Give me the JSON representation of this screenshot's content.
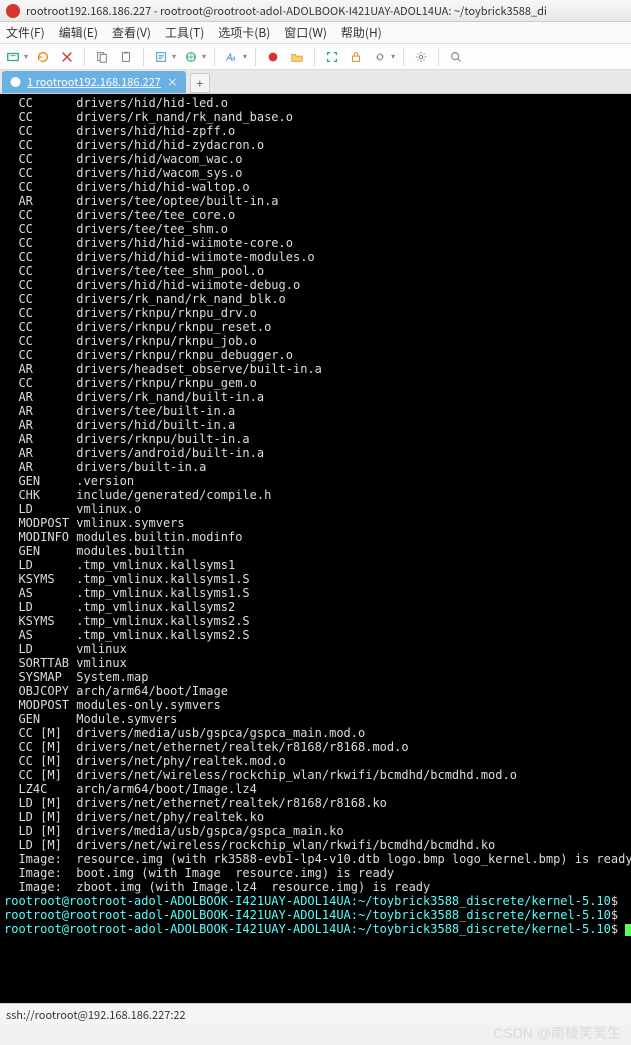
{
  "window": {
    "title": "rootroot192.168.186.227 - rootroot@rootroot-adol-ADOLBOOK-I421UAY-ADOL14UA: ~/toybrick3588_di"
  },
  "menu": {
    "file": "文件(F)",
    "edit": "编辑(E)",
    "view": "查看(V)",
    "tools": "工具(T)",
    "options": "选项卡(B)",
    "window": "窗口(W)",
    "help": "帮助(H)"
  },
  "tab": {
    "label": "1 rootroot192.168.186.227",
    "close": "×",
    "add": "+"
  },
  "status": {
    "text": "ssh://rootroot@192.168.186.227:22"
  },
  "watermark": "CSDN @南棱笑笑生",
  "term": {
    "prompt_path": "rootroot@rootroot-adol-ADOLBOOK-I421UAY-ADOL14UA:~/toybrick3588_discrete/kernel-5.10",
    "dollar": "$",
    "lines": [
      {
        "tag": "CC",
        "txt": "drivers/hid/hid-led.o"
      },
      {
        "tag": "CC",
        "txt": "drivers/rk_nand/rk_nand_base.o"
      },
      {
        "tag": "CC",
        "txt": "drivers/hid/hid-zpff.o"
      },
      {
        "tag": "CC",
        "txt": "drivers/hid/hid-zydacron.o"
      },
      {
        "tag": "CC",
        "txt": "drivers/hid/wacom_wac.o"
      },
      {
        "tag": "CC",
        "txt": "drivers/hid/wacom_sys.o"
      },
      {
        "tag": "CC",
        "txt": "drivers/hid/hid-waltop.o"
      },
      {
        "tag": "AR",
        "txt": "drivers/tee/optee/built-in.a"
      },
      {
        "tag": "CC",
        "txt": "drivers/tee/tee_core.o"
      },
      {
        "tag": "CC",
        "txt": "drivers/tee/tee_shm.o"
      },
      {
        "tag": "CC",
        "txt": "drivers/hid/hid-wiimote-core.o"
      },
      {
        "tag": "CC",
        "txt": "drivers/hid/hid-wiimote-modules.o"
      },
      {
        "tag": "CC",
        "txt": "drivers/tee/tee_shm_pool.o"
      },
      {
        "tag": "CC",
        "txt": "drivers/hid/hid-wiimote-debug.o"
      },
      {
        "tag": "CC",
        "txt": "drivers/rk_nand/rk_nand_blk.o"
      },
      {
        "tag": "CC",
        "txt": "drivers/rknpu/rknpu_drv.o"
      },
      {
        "tag": "CC",
        "txt": "drivers/rknpu/rknpu_reset.o"
      },
      {
        "tag": "CC",
        "txt": "drivers/rknpu/rknpu_job.o"
      },
      {
        "tag": "CC",
        "txt": "drivers/rknpu/rknpu_debugger.o"
      },
      {
        "tag": "AR",
        "txt": "drivers/headset_observe/built-in.a"
      },
      {
        "tag": "CC",
        "txt": "drivers/rknpu/rknpu_gem.o"
      },
      {
        "tag": "AR",
        "txt": "drivers/rk_nand/built-in.a"
      },
      {
        "tag": "AR",
        "txt": "drivers/tee/built-in.a"
      },
      {
        "tag": "AR",
        "txt": "drivers/hid/built-in.a"
      },
      {
        "tag": "AR",
        "txt": "drivers/rknpu/built-in.a"
      },
      {
        "tag": "AR",
        "txt": "drivers/android/built-in.a"
      },
      {
        "tag": "AR",
        "txt": "drivers/built-in.a"
      },
      {
        "tag": "GEN",
        "txt": ".version"
      },
      {
        "tag": "CHK",
        "txt": "include/generated/compile.h"
      },
      {
        "tag": "LD",
        "txt": "vmlinux.o"
      },
      {
        "tag": "MODPOST",
        "txt": "vmlinux.symvers"
      },
      {
        "tag": "MODINFO",
        "txt": "modules.builtin.modinfo"
      },
      {
        "tag": "GEN",
        "txt": "modules.builtin"
      },
      {
        "tag": "LD",
        "txt": ".tmp_vmlinux.kallsyms1"
      },
      {
        "tag": "KSYMS",
        "txt": ".tmp_vmlinux.kallsyms1.S"
      },
      {
        "tag": "AS",
        "txt": ".tmp_vmlinux.kallsyms1.S"
      },
      {
        "tag": "LD",
        "txt": ".tmp_vmlinux.kallsyms2"
      },
      {
        "tag": "KSYMS",
        "txt": ".tmp_vmlinux.kallsyms2.S"
      },
      {
        "tag": "AS",
        "txt": ".tmp_vmlinux.kallsyms2.S"
      },
      {
        "tag": "LD",
        "txt": "vmlinux"
      },
      {
        "tag": "SORTTAB",
        "txt": "vmlinux"
      },
      {
        "tag": "SYSMAP",
        "txt": "System.map"
      },
      {
        "tag": "OBJCOPY",
        "txt": "arch/arm64/boot/Image"
      },
      {
        "tag": "MODPOST",
        "txt": "modules-only.symvers"
      },
      {
        "tag": "GEN",
        "txt": "Module.symvers"
      },
      {
        "tag": "CC [M]",
        "txt": "drivers/media/usb/gspca/gspca_main.mod.o"
      },
      {
        "tag": "CC [M]",
        "txt": "drivers/net/ethernet/realtek/r8168/r8168.mod.o"
      },
      {
        "tag": "CC [M]",
        "txt": "drivers/net/phy/realtek.mod.o"
      },
      {
        "tag": "CC [M]",
        "txt": "drivers/net/wireless/rockchip_wlan/rkwifi/bcmdhd/bcmdhd.mod.o"
      },
      {
        "tag": "LZ4C",
        "txt": "arch/arm64/boot/Image.lz4"
      },
      {
        "tag": "LD [M]",
        "txt": "drivers/net/ethernet/realtek/r8168/r8168.ko"
      },
      {
        "tag": "LD [M]",
        "txt": "drivers/net/phy/realtek.ko"
      },
      {
        "tag": "LD [M]",
        "txt": "drivers/media/usb/gspca/gspca_main.ko"
      },
      {
        "tag": "LD [M]",
        "txt": "drivers/net/wireless/rockchip_wlan/rkwifi/bcmdhd/bcmdhd.ko"
      },
      {
        "tag": "Image:",
        "txt": "resource.img (with rk3588-evb1-lp4-v10.dtb logo.bmp logo_kernel.bmp) is ready"
      },
      {
        "tag": "Image:",
        "txt": "boot.img (with Image  resource.img) is ready"
      },
      {
        "tag": "Image:",
        "txt": "zboot.img (with Image.lz4  resource.img) is ready"
      }
    ]
  }
}
